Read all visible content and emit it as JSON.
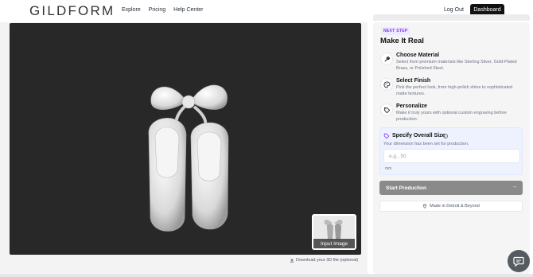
{
  "header": {
    "logo": "GILDFORM",
    "nav": [
      "Explore",
      "Pricing",
      "Help Center"
    ],
    "logout": "Log Out",
    "dashboard": "Dashboard"
  },
  "viewer": {
    "thumbnail_label": "Input Image",
    "download_label": "Download your 3D file (optional)",
    "download_icon": "download-icon",
    "background_color": "#282828"
  },
  "panel": {
    "badge": "NEXT STEP",
    "title": "Make It Real",
    "steps": [
      {
        "title": "Choose Material",
        "desc": "Select from premium materials like Sterling Silver, Gold-Plated Brass, or Polished Steel.",
        "icon": "hammer-icon"
      },
      {
        "title": "Select Finish",
        "desc": "Pick the perfect look, from high-polish shine to sophisticated matte textures.",
        "icon": "palette-icon"
      },
      {
        "title": "Personalize",
        "desc": "Make it truly yours with optional custom engraving before production.",
        "icon": "tag-icon"
      }
    ],
    "size": {
      "title": "Specify Overall Size",
      "subtitle": "Your dimension has been set for production.",
      "placeholder": "e.g., 50",
      "unit": "mm"
    },
    "start_button": "Start Production",
    "made_in": "Made in Detroit & Beyond",
    "accent_color": "#7c3aed"
  }
}
